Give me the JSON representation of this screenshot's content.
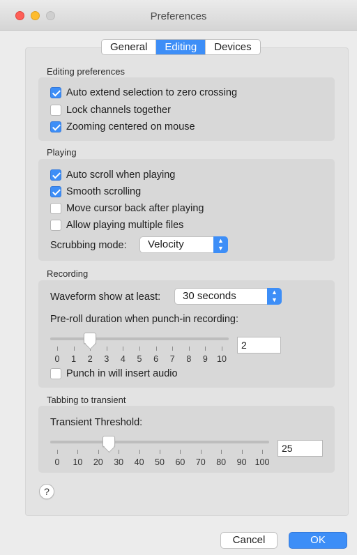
{
  "window": {
    "title": "Preferences"
  },
  "tabs": [
    {
      "label": "General",
      "active": false
    },
    {
      "label": "Editing",
      "active": true
    },
    {
      "label": "Devices",
      "active": false
    }
  ],
  "editing": {
    "title": "Editing preferences",
    "options": [
      {
        "label": "Auto extend selection to zero crossing",
        "checked": true
      },
      {
        "label": "Lock channels together",
        "checked": false
      },
      {
        "label": "Zooming centered on mouse",
        "checked": true
      }
    ]
  },
  "playing": {
    "title": "Playing",
    "options": [
      {
        "label": "Auto scroll when playing",
        "checked": true
      },
      {
        "label": "Smooth scrolling",
        "checked": true
      },
      {
        "label": "Move cursor back after playing",
        "checked": false
      },
      {
        "label": "Allow playing multiple files",
        "checked": false
      }
    ],
    "scrubbing_label": "Scrubbing mode:",
    "scrubbing_value": "Velocity"
  },
  "recording": {
    "title": "Recording",
    "waveform_label": "Waveform show at least:",
    "waveform_value": "30 seconds",
    "preroll_label": "Pre-roll duration when punch-in recording:",
    "preroll_slider": {
      "min": 0,
      "max": 10,
      "value": 2,
      "ticks": [
        "0",
        "1",
        "2",
        "3",
        "4",
        "5",
        "6",
        "7",
        "8",
        "9",
        "10"
      ]
    },
    "preroll_field": "2",
    "punch_in": {
      "label": "Punch in will insert audio",
      "checked": false
    }
  },
  "transient": {
    "title": "Tabbing to transient",
    "threshold_label": "Transient Threshold:",
    "threshold_slider": {
      "min": 0,
      "max": 100,
      "value": 25,
      "ticks": [
        "0",
        "10",
        "20",
        "30",
        "40",
        "50",
        "60",
        "70",
        "80",
        "90",
        "100"
      ]
    },
    "threshold_field": "25"
  },
  "help": "?",
  "buttons": {
    "cancel": "Cancel",
    "ok": "OK"
  },
  "colors": {
    "accent": "#3d8ef7",
    "panel": "#e3e3e3",
    "group": "#d8d8d8"
  }
}
